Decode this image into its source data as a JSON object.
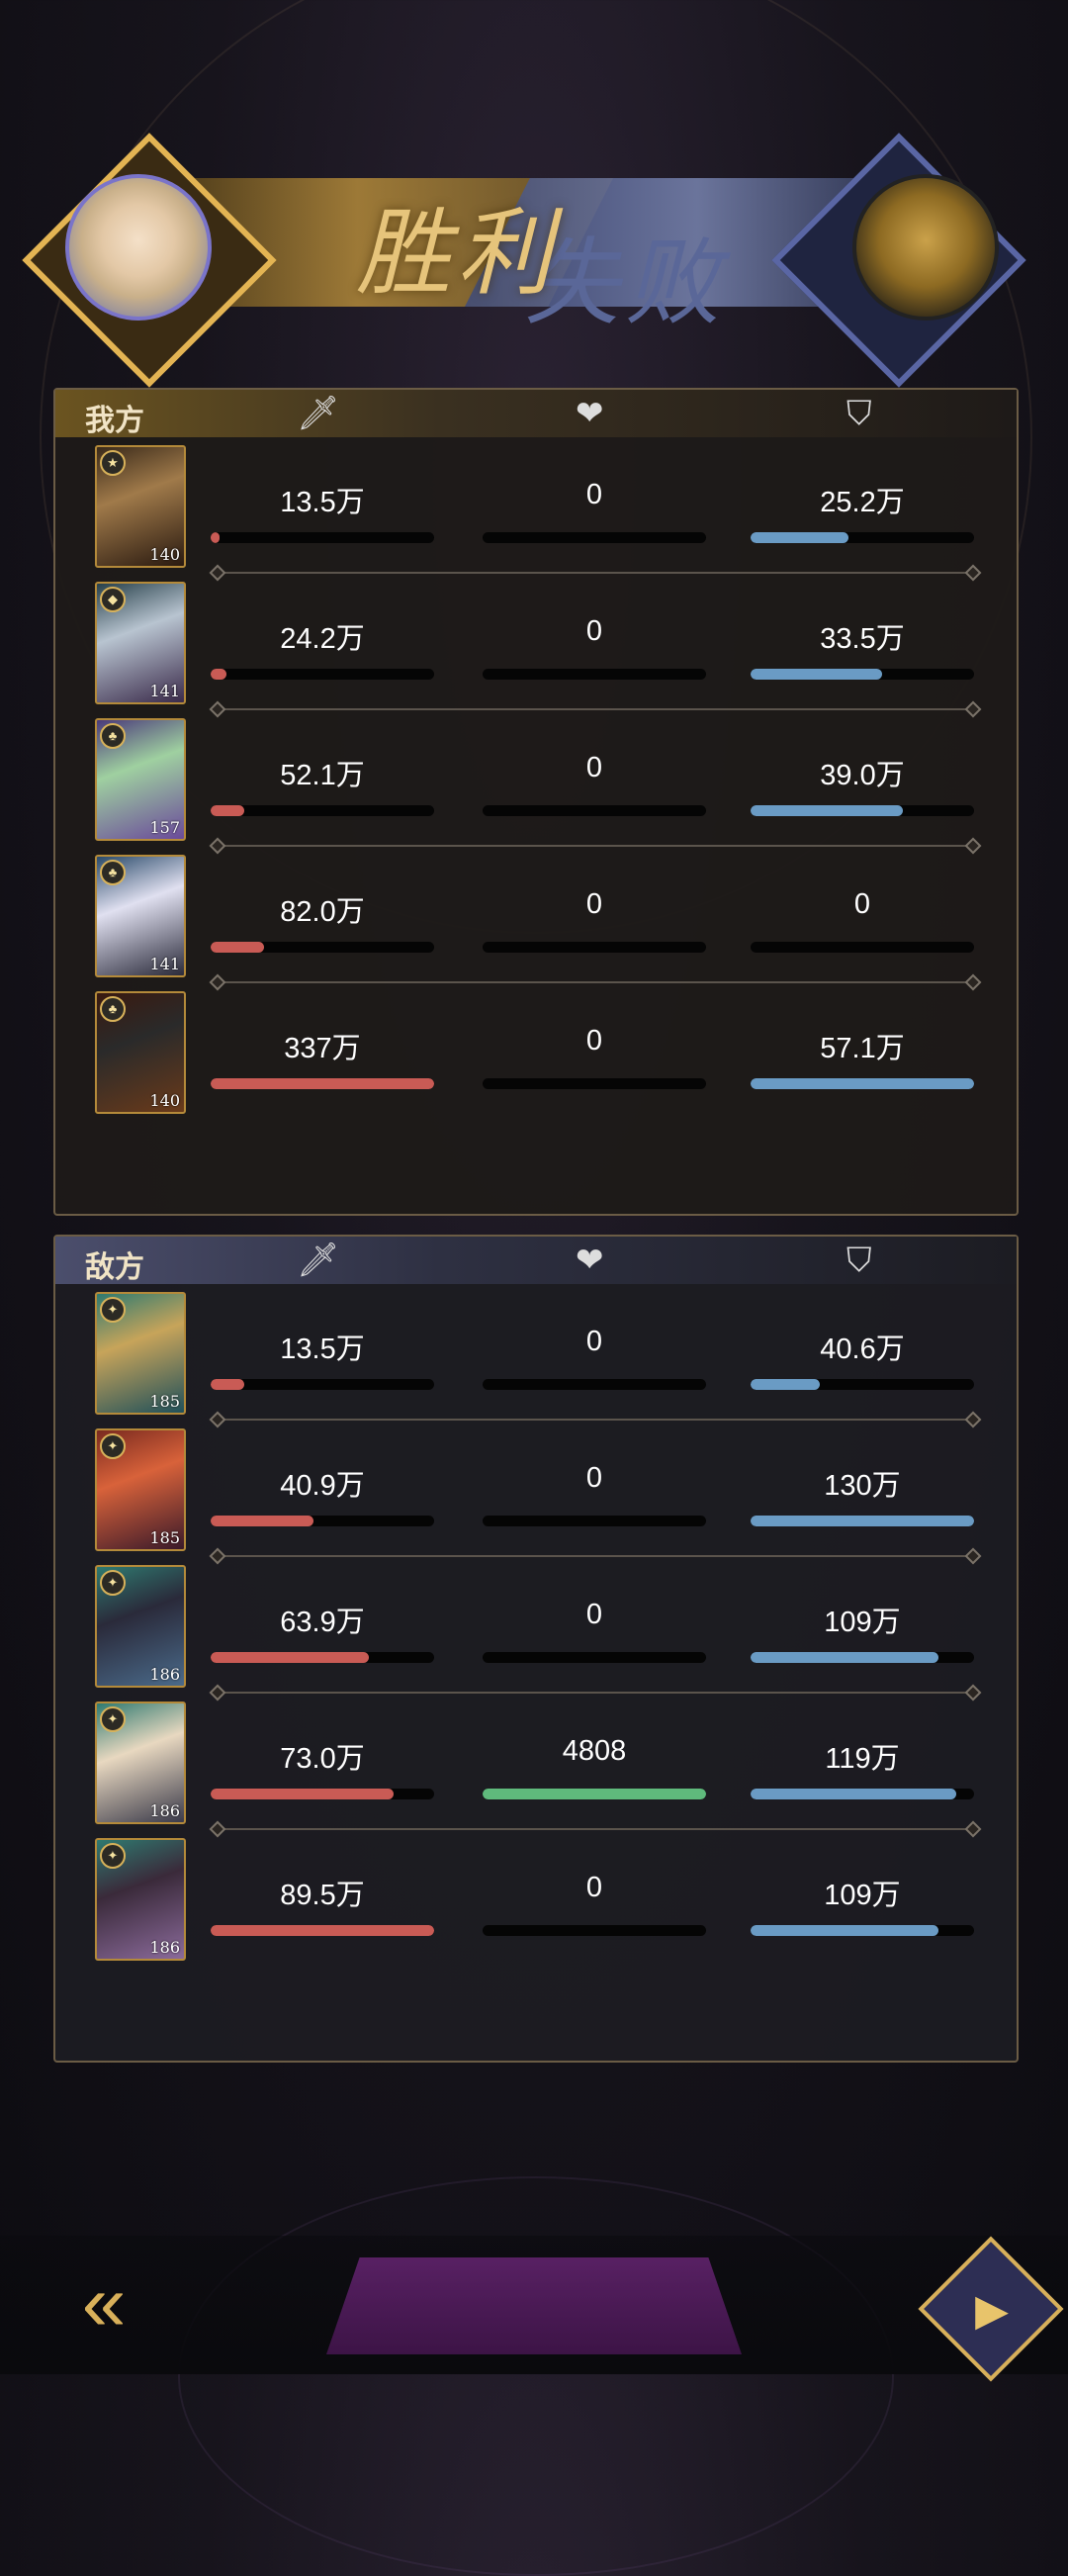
{
  "banner": {
    "win_text": "胜利",
    "lose_text": "失败",
    "left_avatar_icon": "player-portrait",
    "right_avatar_icon": "pharaoh-portrait"
  },
  "header_icons": {
    "damage": "sword-icon",
    "heal": "heart-icon",
    "tank": "shield-icon"
  },
  "colors": {
    "damage_bar": "#c95b55",
    "heal_bar": "#5fba7c",
    "tank_bar": "#6a9bc4",
    "gold_accent": "#d8b05a"
  },
  "our_team": {
    "title": "我方",
    "rows": [
      {
        "level": "140",
        "faction": "★",
        "damage": "13.5万",
        "damage_frac": 0.04,
        "heal": "0",
        "heal_frac": 0,
        "tank": "25.2万",
        "tank_frac": 0.44
      },
      {
        "level": "141",
        "faction": "◆",
        "damage": "24.2万",
        "damage_frac": 0.07,
        "heal": "0",
        "heal_frac": 0,
        "tank": "33.5万",
        "tank_frac": 0.59
      },
      {
        "level": "157",
        "faction": "♣",
        "damage": "52.1万",
        "damage_frac": 0.15,
        "heal": "0",
        "heal_frac": 0,
        "tank": "39.0万",
        "tank_frac": 0.68
      },
      {
        "level": "141",
        "faction": "♣",
        "damage": "82.0万",
        "damage_frac": 0.24,
        "heal": "0",
        "heal_frac": 0,
        "tank": "0",
        "tank_frac": 0
      },
      {
        "level": "140",
        "faction": "♣",
        "damage": "337万",
        "damage_frac": 1.0,
        "heal": "0",
        "heal_frac": 0,
        "tank": "57.1万",
        "tank_frac": 1.0
      }
    ]
  },
  "enemy_team": {
    "title": "敌方",
    "rows": [
      {
        "level": "185",
        "faction": "✦",
        "damage": "13.5万",
        "damage_frac": 0.15,
        "heal": "0",
        "heal_frac": 0,
        "tank": "40.6万",
        "tank_frac": 0.31
      },
      {
        "level": "185",
        "faction": "✦",
        "damage": "40.9万",
        "damage_frac": 0.46,
        "heal": "0",
        "heal_frac": 0,
        "tank": "130万",
        "tank_frac": 1.0
      },
      {
        "level": "186",
        "faction": "✦",
        "damage": "63.9万",
        "damage_frac": 0.71,
        "heal": "0",
        "heal_frac": 0,
        "tank": "109万",
        "tank_frac": 0.84
      },
      {
        "level": "186",
        "faction": "✦",
        "damage": "73.0万",
        "damage_frac": 0.82,
        "heal": "4808",
        "heal_frac": 1.0,
        "tank": "119万",
        "tank_frac": 0.92
      },
      {
        "level": "186",
        "faction": "✦",
        "damage": "89.5万",
        "damage_frac": 1.0,
        "heal": "0",
        "heal_frac": 0,
        "tank": "109万",
        "tank_frac": 0.84
      }
    ]
  },
  "bottom": {
    "back_icon": "back-arrow-icon",
    "replay_icon": "replay-icon"
  }
}
